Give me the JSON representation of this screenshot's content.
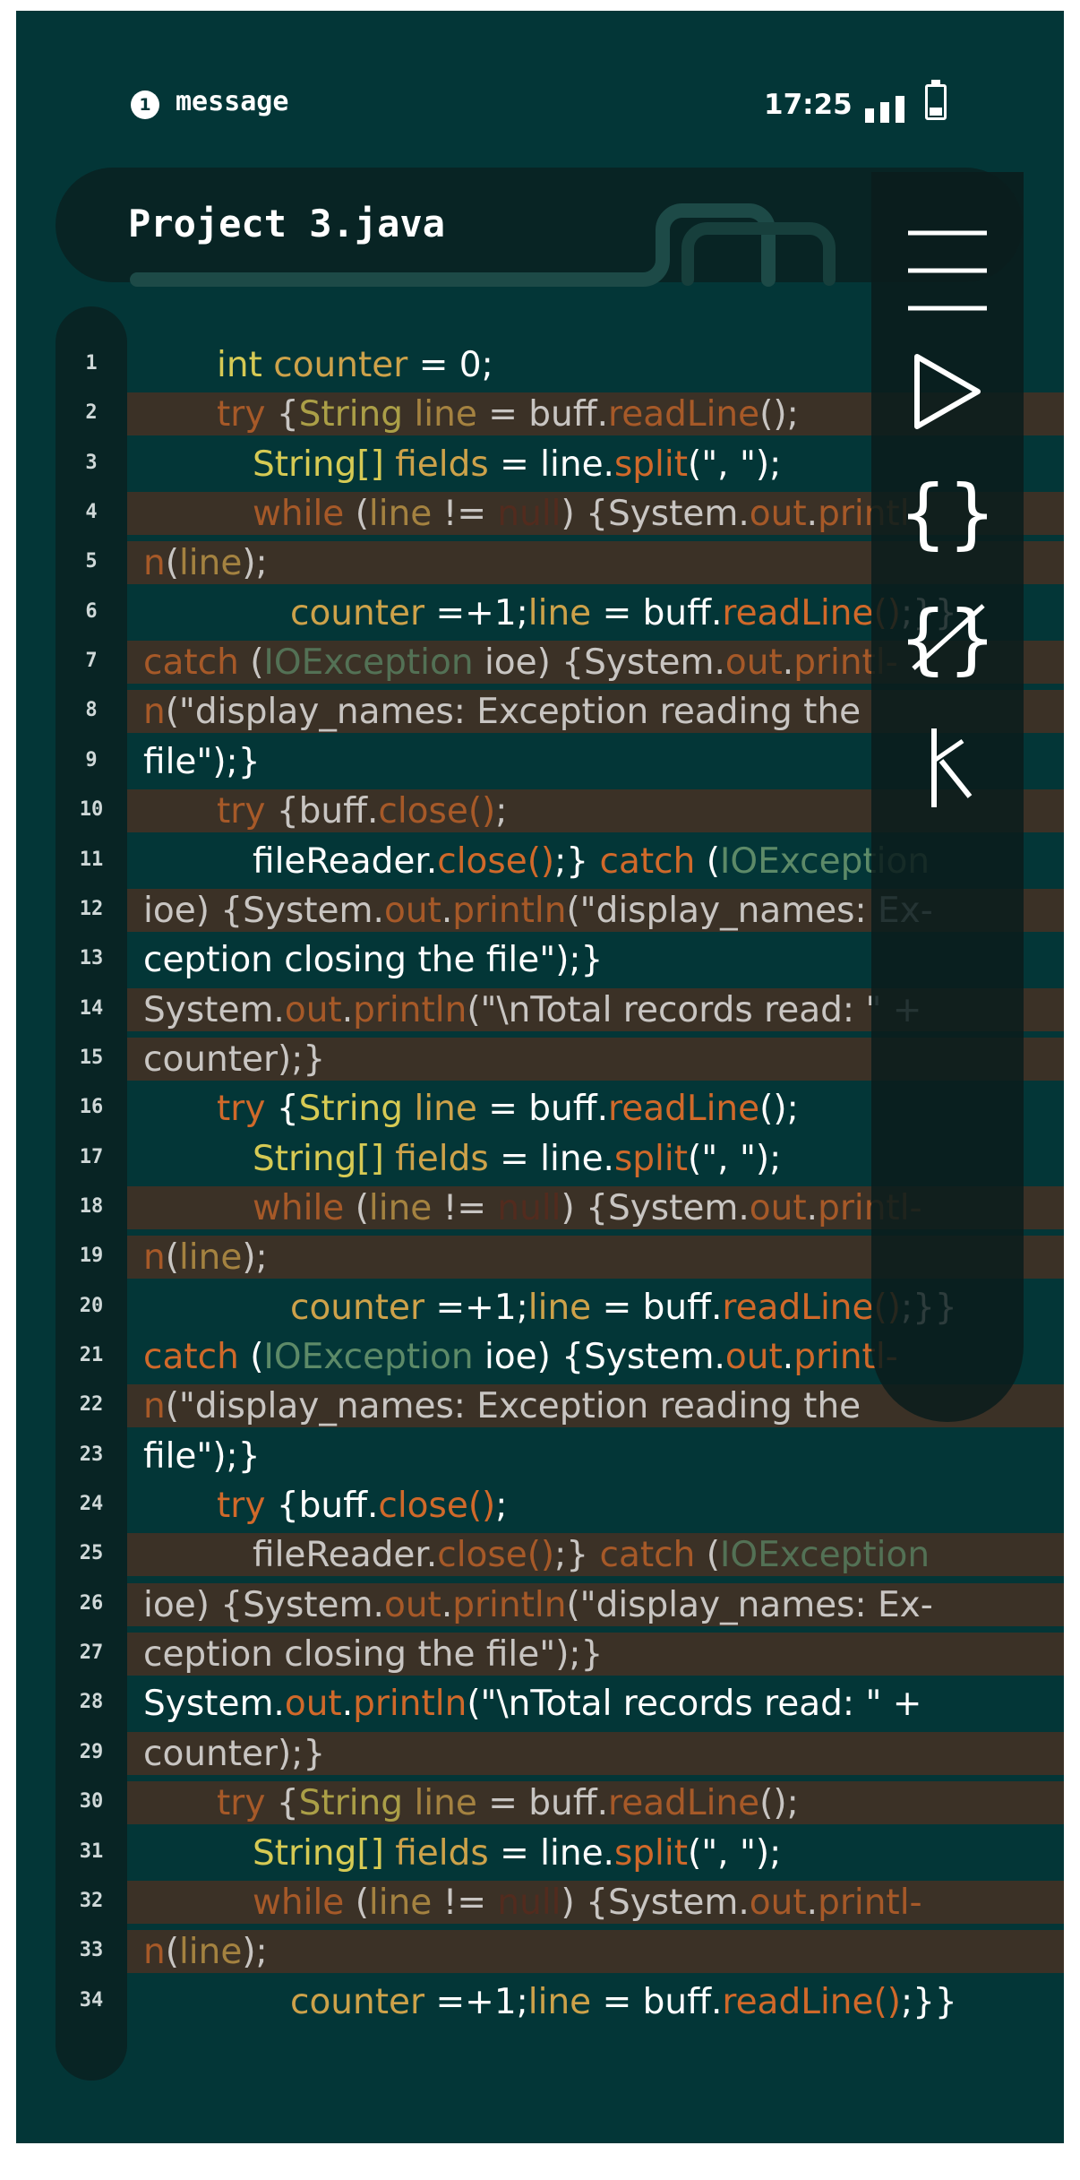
{
  "status_bar": {
    "notification_count": "1",
    "notification_label": "message",
    "time": "17:25"
  },
  "editor": {
    "file_title": "Project 3.java"
  },
  "toolbar": {
    "icons": [
      "menu-icon",
      "run-icon",
      "braces-icon",
      "braces-off-icon",
      "debug-icon"
    ]
  },
  "colors": {
    "background": "#033637",
    "highlight_row": "#3b3126",
    "keyword_yellow": "#d6ca54",
    "method_orange": "#d0692a",
    "class_green": "#5d8a68"
  },
  "line_numbers": [
    "1",
    "2",
    "3",
    "4",
    "5",
    "6",
    "7",
    "8",
    "9",
    "10",
    "11",
    "12",
    "13",
    "14",
    "15",
    "16",
    "17",
    "18",
    "19",
    "20",
    "21",
    "22",
    "23",
    "24",
    "25",
    "26",
    "27",
    "28",
    "29",
    "30",
    "31",
    "32",
    "33",
    "34"
  ],
  "code": {
    "lines": [
      {
        "hl": false,
        "indent": 1,
        "t": [
          [
            "k",
            "int "
          ],
          [
            "v",
            "counter"
          ],
          [
            "w",
            " = 0;"
          ]
        ]
      },
      {
        "hl": true,
        "indent": 1,
        "t": [
          [
            "o",
            "try "
          ],
          [
            "w",
            "{"
          ],
          [
            "k",
            "String "
          ],
          [
            "v",
            "line"
          ],
          [
            "w",
            " = buff."
          ],
          [
            "o",
            "readLine"
          ],
          [
            "w",
            "();"
          ]
        ]
      },
      {
        "hl": false,
        "indent": 2,
        "t": [
          [
            "k",
            "String[] "
          ],
          [
            "v",
            "fields"
          ],
          [
            "w",
            " = line."
          ],
          [
            "o",
            "split"
          ],
          [
            "w",
            "(\", \");"
          ]
        ]
      },
      {
        "hl": true,
        "indent": 2,
        "t": [
          [
            "o",
            "while "
          ],
          [
            "w",
            "("
          ],
          [
            "v",
            "line"
          ],
          [
            "w",
            " != "
          ],
          [
            "n",
            "null"
          ],
          [
            "w",
            ") {System."
          ],
          [
            "o",
            "out"
          ],
          [
            "w",
            "."
          ],
          [
            "o",
            "printl-"
          ]
        ]
      },
      {
        "hl": true,
        "indent": 0,
        "t": [
          [
            "o",
            "n"
          ],
          [
            "w",
            "("
          ],
          [
            "v",
            "line"
          ],
          [
            "w",
            ");"
          ]
        ]
      },
      {
        "hl": false,
        "indent": 3,
        "t": [
          [
            "v",
            "counter"
          ],
          [
            "w",
            " =+1;"
          ],
          [
            "v",
            "line"
          ],
          [
            "w",
            " = buff."
          ],
          [
            "o",
            "readLine"
          ],
          [
            "o",
            "()"
          ],
          [
            "w",
            ";}}"
          ]
        ]
      },
      {
        "hl": true,
        "indent": 0,
        "t": [
          [
            "o",
            "catch "
          ],
          [
            "w",
            "("
          ],
          [
            "g",
            "IOException "
          ],
          [
            "w",
            "ioe) {System."
          ],
          [
            "o",
            "out"
          ],
          [
            "w",
            "."
          ],
          [
            "o",
            "printl-"
          ]
        ]
      },
      {
        "hl": true,
        "indent": 0,
        "t": [
          [
            "o",
            "n"
          ],
          [
            "w",
            "(\"display_names: Exception reading the"
          ]
        ]
      },
      {
        "hl": false,
        "indent": 0,
        "t": [
          [
            "w",
            "file\");}"
          ]
        ]
      },
      {
        "hl": true,
        "indent": 1,
        "t": [
          [
            "o",
            "try "
          ],
          [
            "w",
            "{buff."
          ],
          [
            "o",
            "close()"
          ],
          [
            "w",
            ";"
          ]
        ]
      },
      {
        "hl": false,
        "indent": 2,
        "t": [
          [
            "w",
            "fileReader."
          ],
          [
            "o",
            "close()"
          ],
          [
            "w",
            ";} "
          ],
          [
            "o",
            "catch "
          ],
          [
            "w",
            "("
          ],
          [
            "g",
            "IOException"
          ]
        ]
      },
      {
        "hl": true,
        "indent": 0,
        "t": [
          [
            "w",
            "ioe) {System."
          ],
          [
            "o",
            "out"
          ],
          [
            "w",
            "."
          ],
          [
            "o",
            "println"
          ],
          [
            "w",
            "(\"display_names: Ex-"
          ]
        ]
      },
      {
        "hl": false,
        "indent": 0,
        "t": [
          [
            "w",
            "ception closing the file\");}"
          ]
        ]
      },
      {
        "hl": true,
        "indent": 0,
        "t": [
          [
            "w",
            "System."
          ],
          [
            "o",
            "out"
          ],
          [
            "w",
            "."
          ],
          [
            "o",
            "println"
          ],
          [
            "w",
            "(\"\\nTotal records read: \" +"
          ]
        ]
      },
      {
        "hl": true,
        "indent": 0,
        "t": [
          [
            "w",
            "counter);}"
          ]
        ]
      },
      {
        "hl": false,
        "indent": 1,
        "t": [
          [
            "o",
            "try "
          ],
          [
            "w",
            "{"
          ],
          [
            "k",
            "String "
          ],
          [
            "v",
            "line"
          ],
          [
            "w",
            " = buff."
          ],
          [
            "o",
            "readLine"
          ],
          [
            "w",
            "();"
          ]
        ]
      },
      {
        "hl": false,
        "indent": 2,
        "t": [
          [
            "k",
            "String[] "
          ],
          [
            "v",
            "fields"
          ],
          [
            "w",
            " = line."
          ],
          [
            "o",
            "split"
          ],
          [
            "w",
            "(\", \");"
          ]
        ]
      },
      {
        "hl": true,
        "indent": 2,
        "t": [
          [
            "o",
            "while "
          ],
          [
            "w",
            "("
          ],
          [
            "v",
            "line"
          ],
          [
            "w",
            " != "
          ],
          [
            "n",
            "null"
          ],
          [
            "w",
            ") {System."
          ],
          [
            "o",
            "out"
          ],
          [
            "w",
            "."
          ],
          [
            "o",
            "printl-"
          ]
        ]
      },
      {
        "hl": true,
        "indent": 0,
        "t": [
          [
            "o",
            "n"
          ],
          [
            "w",
            "("
          ],
          [
            "v",
            "line"
          ],
          [
            "w",
            ");"
          ]
        ]
      },
      {
        "hl": false,
        "indent": 3,
        "t": [
          [
            "v",
            "counter"
          ],
          [
            "w",
            " =+1;"
          ],
          [
            "v",
            "line"
          ],
          [
            "w",
            " = buff."
          ],
          [
            "o",
            "readLine"
          ],
          [
            "o",
            "()"
          ],
          [
            "w",
            ";}}"
          ]
        ]
      },
      {
        "hl": false,
        "indent": 0,
        "t": [
          [
            "o",
            "catch "
          ],
          [
            "w",
            "("
          ],
          [
            "g",
            "IOException "
          ],
          [
            "w",
            "ioe) {System."
          ],
          [
            "o",
            "out"
          ],
          [
            "w",
            "."
          ],
          [
            "o",
            "printl-"
          ]
        ]
      },
      {
        "hl": true,
        "indent": 0,
        "t": [
          [
            "o",
            "n"
          ],
          [
            "w",
            "(\"display_names: Exception reading the"
          ]
        ]
      },
      {
        "hl": false,
        "indent": 0,
        "t": [
          [
            "w",
            "file\");}"
          ]
        ]
      },
      {
        "hl": false,
        "indent": 1,
        "t": [
          [
            "o",
            "try "
          ],
          [
            "w",
            "{buff."
          ],
          [
            "o",
            "close()"
          ],
          [
            "w",
            ";"
          ]
        ]
      },
      {
        "hl": true,
        "indent": 2,
        "t": [
          [
            "w",
            "fileReader."
          ],
          [
            "o",
            "close()"
          ],
          [
            "w",
            ";} "
          ],
          [
            "o",
            "catch "
          ],
          [
            "w",
            "("
          ],
          [
            "g",
            "IOException"
          ]
        ]
      },
      {
        "hl": true,
        "indent": 0,
        "t": [
          [
            "w",
            "ioe) {System."
          ],
          [
            "o",
            "out"
          ],
          [
            "w",
            "."
          ],
          [
            "o",
            "println"
          ],
          [
            "w",
            "(\"display_names: Ex-"
          ]
        ]
      },
      {
        "hl": true,
        "indent": 0,
        "t": [
          [
            "w",
            "ception closing the file\");}"
          ]
        ]
      },
      {
        "hl": false,
        "indent": 0,
        "t": [
          [
            "w",
            "System."
          ],
          [
            "o",
            "out"
          ],
          [
            "w",
            "."
          ],
          [
            "o",
            "println"
          ],
          [
            "w",
            "(\"\\nTotal records read: \" +"
          ]
        ]
      },
      {
        "hl": true,
        "indent": 0,
        "t": [
          [
            "w",
            "counter);}"
          ]
        ]
      },
      {
        "hl": true,
        "indent": 1,
        "t": [
          [
            "o",
            "try "
          ],
          [
            "w",
            "{"
          ],
          [
            "k",
            "String "
          ],
          [
            "v",
            "line"
          ],
          [
            "w",
            " = buff."
          ],
          [
            "o",
            "readLine"
          ],
          [
            "w",
            "();"
          ]
        ]
      },
      {
        "hl": false,
        "indent": 2,
        "t": [
          [
            "k",
            "String[] "
          ],
          [
            "v",
            "fields"
          ],
          [
            "w",
            " = line."
          ],
          [
            "o",
            "split"
          ],
          [
            "w",
            "(\", \");"
          ]
        ]
      },
      {
        "hl": true,
        "indent": 2,
        "t": [
          [
            "o",
            "while "
          ],
          [
            "w",
            "("
          ],
          [
            "v",
            "line"
          ],
          [
            "w",
            " != "
          ],
          [
            "n",
            "null"
          ],
          [
            "w",
            ") {System."
          ],
          [
            "o",
            "out"
          ],
          [
            "w",
            "."
          ],
          [
            "o",
            "printl-"
          ]
        ]
      },
      {
        "hl": true,
        "indent": 0,
        "t": [
          [
            "o",
            "n"
          ],
          [
            "w",
            "("
          ],
          [
            "v",
            "line"
          ],
          [
            "w",
            ");"
          ]
        ]
      },
      {
        "hl": false,
        "indent": 3,
        "t": [
          [
            "v",
            "counter"
          ],
          [
            "w",
            " =+1;"
          ],
          [
            "v",
            "line"
          ],
          [
            "w",
            " = buff."
          ],
          [
            "o",
            "readLine"
          ],
          [
            "o",
            "()"
          ],
          [
            "w",
            ";}}"
          ]
        ]
      }
    ]
  }
}
